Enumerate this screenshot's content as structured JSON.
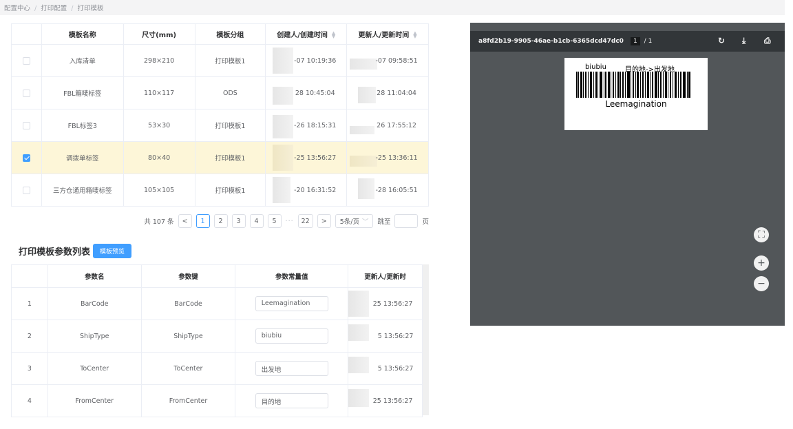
{
  "breadcrumb": [
    "配置中心",
    "打印配置",
    "打印模板"
  ],
  "template_table": {
    "headers": [
      "",
      "模板名称",
      "尺寸(mm)",
      "模板分组",
      "创建人/创建时间",
      "更新人/更新时间"
    ],
    "rows": [
      {
        "checked": false,
        "name": "入库清单",
        "size": "298×210",
        "group": "打印模板1",
        "created": "-07 10:19:36",
        "updated": "-07 09:58:51"
      },
      {
        "checked": false,
        "name": "FBL箱唛标签",
        "size": "110×117",
        "group": "ODS",
        "created": "28 10:45:04",
        "updated": "28 11:04:04"
      },
      {
        "checked": false,
        "name": "FBL标签3",
        "size": "53×30",
        "group": "打印模板1",
        "created": "-26 18:15:31",
        "updated": "26 17:55:12"
      },
      {
        "checked": true,
        "name": "调拨单标签",
        "size": "80×40",
        "group": "打印模板1",
        "created": "-25 13:56:27",
        "updated": "-25 13:36:11"
      },
      {
        "checked": false,
        "name": "三方仓通用箱唛标签",
        "size": "105×105",
        "group": "打印模板1",
        "created": "-20 16:31:52",
        "updated": "-28 16:05:51"
      }
    ]
  },
  "pagination": {
    "total": "共 107 条",
    "prev": "<",
    "pages": [
      "1",
      "2",
      "3",
      "4",
      "5"
    ],
    "dots": "···",
    "last": "22",
    "next": ">",
    "page_size": "5条/页",
    "jump_label": "跳至",
    "page_unit": "页"
  },
  "params_section": {
    "title": "打印模板参数列表",
    "preview_button": "模板预览",
    "headers": [
      "",
      "参数名",
      "参数键",
      "参数常量值",
      "更新人/更新时"
    ],
    "rows": [
      {
        "idx": "1",
        "name": "BarCode",
        "key": "BarCode",
        "value": "Leemagination",
        "updated": "25 13:56:27"
      },
      {
        "idx": "2",
        "name": "ShipType",
        "key": "ShipType",
        "value": "biubiu",
        "updated": "5 13:56:27"
      },
      {
        "idx": "3",
        "name": "ToCenter",
        "key": "ToCenter",
        "value": "出发地",
        "updated": "5 13:56:27"
      },
      {
        "idx": "4",
        "name": "FromCenter",
        "key": "FromCenter",
        "value": "目的地",
        "updated": "25 13:56:27"
      }
    ]
  },
  "viewer": {
    "file_name": "a8fd2b19-9905-46ae-b1cb-6365dcd47dc0",
    "page": "1",
    "page_total": "/ 1",
    "label": {
      "ship_type": "biubiu",
      "route": "目的地->出发地",
      "barcode_text": "Leemagination"
    },
    "icons": [
      "rotate-icon",
      "download-icon",
      "print-icon",
      "fit-page-icon",
      "zoom-in-icon",
      "zoom-out-icon"
    ]
  }
}
